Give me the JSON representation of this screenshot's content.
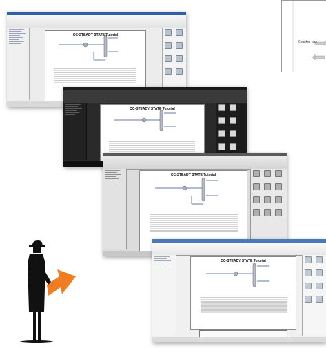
{
  "screenshots": [
    {
      "theme": "light",
      "doc_title": "CC-STEADY STATE Tutorial"
    },
    {
      "theme": "dark",
      "doc_title": "CC-STEADY STATE Tutorial"
    },
    {
      "theme": "grey",
      "doc_title": "CC-STEADY STATE Tutorial"
    },
    {
      "theme": "light2",
      "doc_title": "CC-STEADY STATE Tutorial"
    }
  ],
  "corner_panel": {
    "label": "Cracker gas"
  },
  "figure": {
    "description_icon": "man-with-orange-arrow-silhouette"
  },
  "colors": {
    "accent_orange": "#f07d22",
    "flow_blue": "#2b4f8f"
  }
}
